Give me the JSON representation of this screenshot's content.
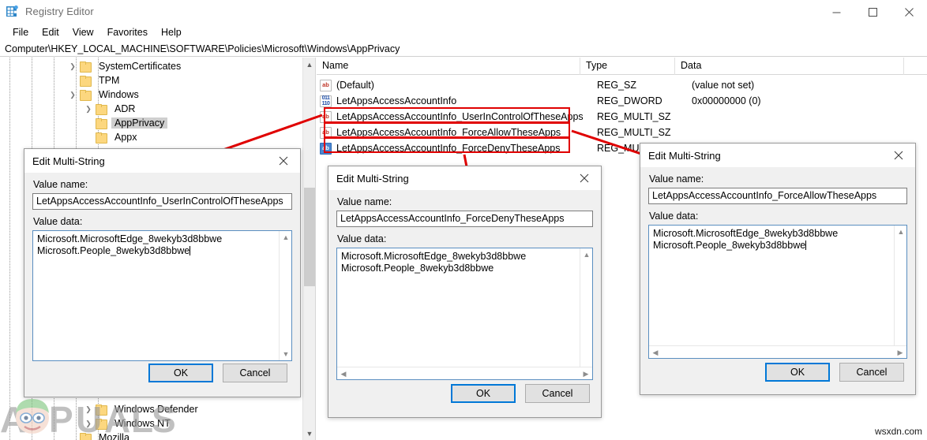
{
  "window": {
    "title": "Registry Editor",
    "icon": "registry-editor-icon",
    "controls": {
      "minimize": "minimize-icon",
      "maximize": "maximize-icon",
      "close": "close-icon"
    }
  },
  "menubar": {
    "items": [
      "File",
      "Edit",
      "View",
      "Favorites",
      "Help"
    ]
  },
  "address_bar": {
    "path": "Computer\\HKEY_LOCAL_MACHINE\\SOFTWARE\\Policies\\Microsoft\\Windows\\AppPrivacy"
  },
  "tree": {
    "nodes": [
      {
        "label": "SystemCertificates",
        "indent": 1,
        "twisty": "collapsed",
        "selected": false
      },
      {
        "label": "TPM",
        "indent": 1,
        "twisty": "none",
        "selected": false
      },
      {
        "label": "Windows",
        "indent": 1,
        "twisty": "expanded",
        "selected": false
      },
      {
        "label": "ADR",
        "indent": 2,
        "twisty": "collapsed",
        "selected": false
      },
      {
        "label": "AppPrivacy",
        "indent": 2,
        "twisty": "none",
        "selected": true
      },
      {
        "label": "Appx",
        "indent": 2,
        "twisty": "none",
        "selected": false
      }
    ],
    "bottom_nodes": [
      {
        "label": "Windows Defender",
        "indent": 2,
        "twisty": "collapsed",
        "selected": false
      },
      {
        "label": "Windows NT",
        "indent": 2,
        "twisty": "collapsed",
        "selected": false
      },
      {
        "label": "Mozilla",
        "indent": 1,
        "twisty": "none",
        "selected": false
      }
    ],
    "scrollbar": {
      "up": "scroll-up-icon",
      "down": "scroll-down-icon"
    }
  },
  "list": {
    "columns": [
      "Name",
      "Type",
      "Data"
    ],
    "rows": [
      {
        "name": "(Default)",
        "type": "REG_SZ",
        "data": "(value not set)",
        "icon": "string-value-icon",
        "highlighted": false,
        "selected": false
      },
      {
        "name": "LetAppsAccessAccountInfo",
        "type": "REG_DWORD",
        "data": "0x00000000 (0)",
        "icon": "dword-value-icon",
        "highlighted": false,
        "selected": false
      },
      {
        "name": "LetAppsAccessAccountInfo_UserInControlOfTheseApps",
        "type": "REG_MULTI_SZ",
        "data": "",
        "icon": "string-value-icon",
        "highlighted": true,
        "selected": false
      },
      {
        "name": "LetAppsAccessAccountInfo_ForceAllowTheseApps",
        "type": "REG_MULTI_SZ",
        "data": "",
        "icon": "string-value-icon",
        "highlighted": true,
        "selected": false
      },
      {
        "name": "LetAppsAccessAccountInfo_ForceDenyTheseApps",
        "type": "REG_MULTI_SZ",
        "data": "",
        "icon": "string-value-icon",
        "highlighted": true,
        "selected": true
      }
    ]
  },
  "dialogs": {
    "left": {
      "title": "Edit Multi-String",
      "close": "close-icon",
      "value_name_label": "Value name:",
      "value_name": "LetAppsAccessAccountInfo_UserInControlOfTheseApps",
      "value_data_label": "Value data:",
      "value_data_lines": [
        "Microsoft.MicrosoftEdge_8wekyb3d8bbwe",
        "Microsoft.People_8wekyb3d8bbwe"
      ],
      "ok": "OK",
      "cancel": "Cancel"
    },
    "middle": {
      "title": "Edit Multi-String",
      "close": "close-icon",
      "value_name_label": "Value name:",
      "value_name": "LetAppsAccessAccountInfo_ForceDenyTheseApps",
      "value_data_label": "Value data:",
      "value_data_lines": [
        "Microsoft.MicrosoftEdge_8wekyb3d8bbwe",
        "Microsoft.People_8wekyb3d8bbwe"
      ],
      "ok": "OK",
      "cancel": "Cancel"
    },
    "right": {
      "title": "Edit Multi-String",
      "close": "close-icon",
      "value_name_label": "Value name:",
      "value_name": "LetAppsAccessAccountInfo_ForceAllowTheseApps",
      "value_data_label": "Value data:",
      "value_data_lines": [
        "Microsoft.MicrosoftEdge_8wekyb3d8bbwe",
        "Microsoft.People_8wekyb3d8bbwe"
      ],
      "ok": "OK",
      "cancel": "Cancel"
    }
  },
  "annotations": {
    "highlight_color": "#e00000",
    "boxes": 3,
    "arrows": 3
  },
  "watermarks": {
    "brand": "APPUALS",
    "corner": "wsxdn.com"
  },
  "colors": {
    "accent": "#0078d7",
    "annotation": "#e00000",
    "folder": "#fcd77f",
    "selection": "#cfcfcf"
  }
}
